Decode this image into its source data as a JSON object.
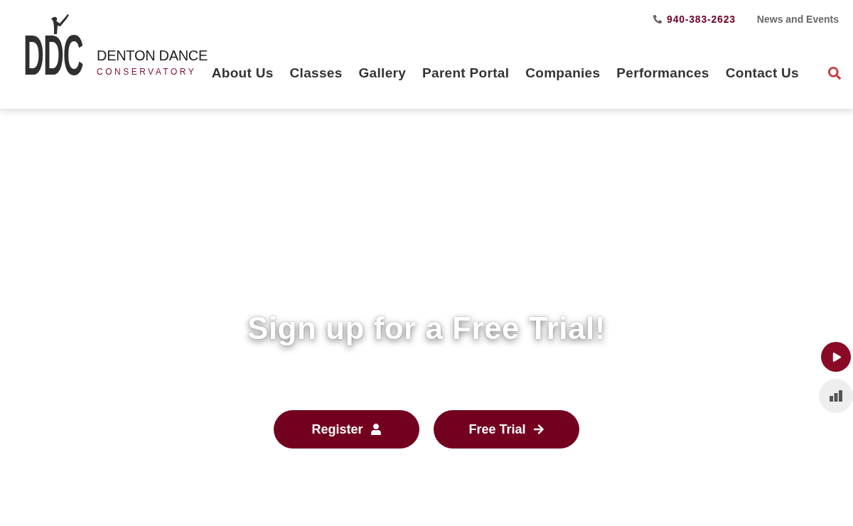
{
  "header": {
    "logo": {
      "letters": "DDC",
      "name": "DENTON DANCE",
      "tagline": "CONSERVATORY"
    },
    "phone": "940-383-2623",
    "top_links": [
      "News and Events"
    ],
    "nav": [
      "About Us",
      "Classes",
      "Gallery",
      "Parent Portal",
      "Companies",
      "Performances",
      "Contact Us"
    ]
  },
  "hero": {
    "heading": "Sign up for a Free Trial!",
    "buttons": [
      {
        "label": "Register",
        "kind": "register"
      },
      {
        "label": "Free Trial",
        "kind": "trial"
      }
    ]
  },
  "side_buttons": [
    {
      "kind": "play"
    },
    {
      "kind": "stats"
    }
  ]
}
